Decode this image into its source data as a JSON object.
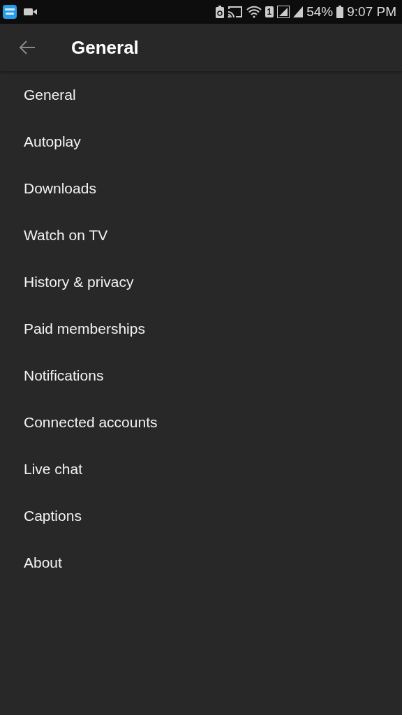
{
  "status_bar": {
    "sim_slot": "1",
    "battery_percent": "54%",
    "time": "9:07 PM"
  },
  "app_bar": {
    "title": "General"
  },
  "items": [
    {
      "label": "General"
    },
    {
      "label": "Autoplay"
    },
    {
      "label": "Downloads"
    },
    {
      "label": "Watch on TV"
    },
    {
      "label": "History & privacy"
    },
    {
      "label": "Paid memberships"
    },
    {
      "label": "Notifications"
    },
    {
      "label": "Connected accounts"
    },
    {
      "label": "Live chat"
    },
    {
      "label": "Captions"
    },
    {
      "label": "About"
    }
  ]
}
